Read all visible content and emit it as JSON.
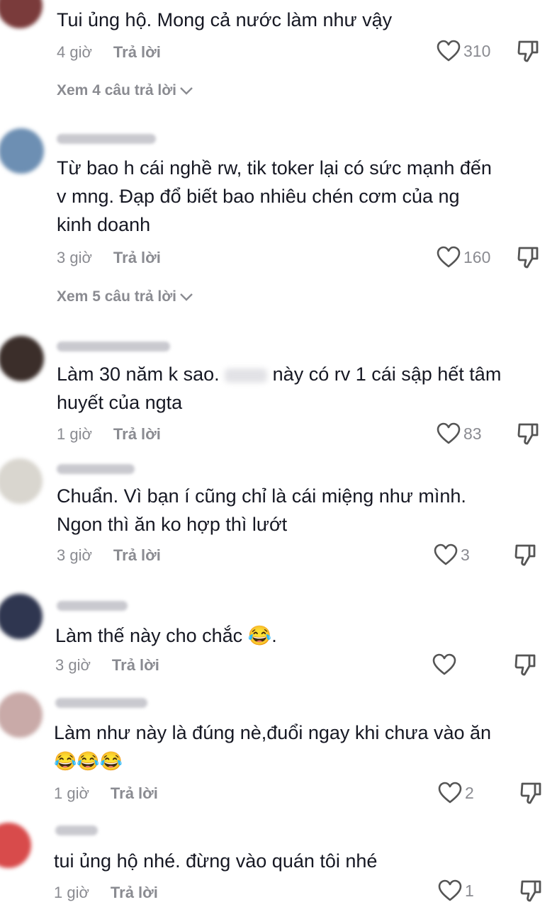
{
  "comments": [
    {
      "text": [
        "Tui ủng hộ. Mong cả nước làm như vậy"
      ],
      "time": "4 giờ",
      "reply": "Trả lời",
      "likes": "310",
      "view_replies": "Xem 4 câu trả lời"
    },
    {
      "text": [
        "Từ bao h cái nghề rw, tik toker lại có sức mạnh đến",
        "v mng. Đạp đổ biết bao nhiêu chén cơm của ng",
        "kinh doanh"
      ],
      "time": "3 giờ",
      "reply": "Trả lời",
      "likes": "160",
      "view_replies": "Xem 5 câu trả lời"
    },
    {
      "text_prefix": "Làm 30 năm k sao.",
      "text_suffix": "này có rv 1 cái sập hết tâm",
      "text_line2": "huyết của ngta",
      "time": "1 giờ",
      "reply": "Trả lời",
      "likes": "83"
    },
    {
      "text": [
        "Chuẩn. Vì bạn í cũng chỉ là cái miệng như mình.",
        "Ngon thì ăn ko hợp thì lướt"
      ],
      "time": "3 giờ",
      "reply": "Trả lời",
      "likes": "3"
    },
    {
      "text": [
        "Làm thế này cho chắc 😂."
      ],
      "time": "3 giờ",
      "reply": "Trả lời",
      "likes": ""
    },
    {
      "text": [
        "Làm như này là đúng nè,đuổi ngay khi chưa vào ăn",
        "😂😂😂"
      ],
      "time": "1 giờ",
      "reply": "Trả lời",
      "likes": "2"
    },
    {
      "text": [
        "tui ủng hộ nhé. đừng vào quán tôi nhé"
      ],
      "time": "1 giờ",
      "reply": "Trả lời",
      "likes": "1"
    }
  ],
  "colors": {
    "text": "#161823",
    "muted": "#8a8b91"
  },
  "icons": {
    "like": "heart-outline-icon",
    "dislike": "thumbs-down-icon",
    "expand": "chevron-down-icon"
  }
}
